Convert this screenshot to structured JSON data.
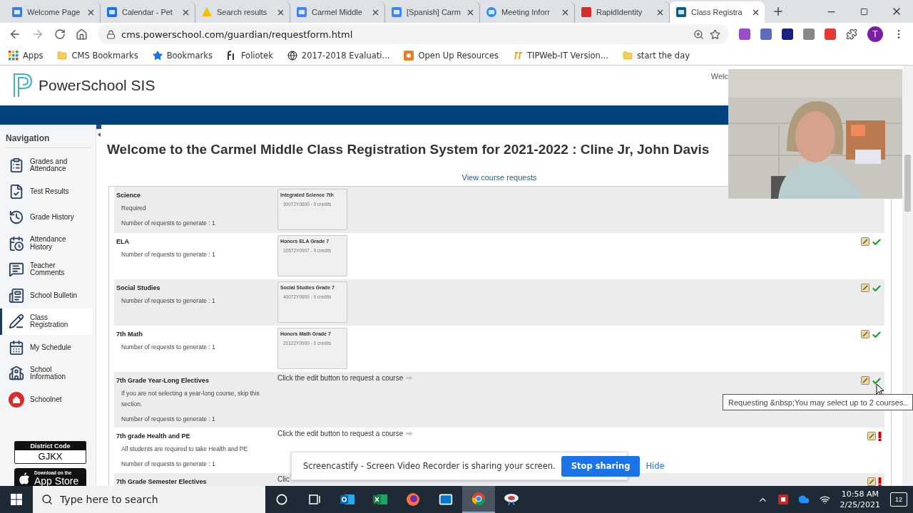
{
  "browser": {
    "tabs": [
      {
        "title": "Welcome Page",
        "selected": false
      },
      {
        "title": "Calendar - Pet",
        "selected": false
      },
      {
        "title": "Search results",
        "selected": false
      },
      {
        "title": "Carmel Middle",
        "selected": false
      },
      {
        "title": "[Spanish] Carm",
        "selected": false
      },
      {
        "title": "Meeting Inforr",
        "selected": false
      },
      {
        "title": "RapidIdentity",
        "selected": false
      },
      {
        "title": "Class Registra",
        "selected": true
      }
    ],
    "url": "cms.powerschool.com/guardian/requestform.html",
    "profile": "T",
    "bookmarks": [
      "Apps",
      "CMS Bookmarks",
      "Bookmarks",
      "Foliotek",
      "2017-2018 Evaluati...",
      "Open Up Resources",
      "TIPWeb-IT Version...",
      "start the day"
    ]
  },
  "header": {
    "logo": "PowerSchool SIS",
    "welcome": "Welc"
  },
  "sidebar": {
    "heading": "Navigation",
    "items": [
      {
        "label": "Grades and\nAttendance",
        "selected": false
      },
      {
        "label": "Test Results",
        "selected": false
      },
      {
        "label": "Grade History",
        "selected": false
      },
      {
        "label": "Attendance\nHistory",
        "selected": false
      },
      {
        "label": "Teacher\nComments",
        "selected": false
      },
      {
        "label": "School Bulletin",
        "selected": false
      },
      {
        "label": "Class\nRegistration",
        "selected": true
      },
      {
        "label": "My Schedule",
        "selected": false
      },
      {
        "label": "School\nInformation",
        "selected": false
      },
      {
        "label": "Schoolnet",
        "selected": false
      }
    ],
    "district_code": {
      "label": "District Code",
      "value": "GJKX"
    },
    "app_store": {
      "small": "Download on the",
      "big": "App Store"
    }
  },
  "main": {
    "title": "Welcome to the Carmel Middle Class Registration System for 2021-2022 : Cline Jr, John Davis",
    "link": "View course requests",
    "sections": [
      {
        "kind": "course",
        "title": "Science",
        "notes": [
          "Required"
        ],
        "requests": "Number of requests to generate : 1",
        "course": {
          "name": "Integrated Science 7th",
          "code": "30072Y0800 - 0 credits"
        }
      },
      {
        "kind": "course",
        "title": "ELA",
        "requests": "Number of requests to generate : 1",
        "course": {
          "name": "Honors ELA Grade 7",
          "code": "10572Y0907 - 0 credits"
        },
        "complete": true
      },
      {
        "kind": "course",
        "title": "Social Studies",
        "requests": "Number of requests to generate : 1",
        "course": {
          "name": "Social Studies Grade 7",
          "code": "40072Y0800 - 0 credits"
        },
        "complete": true
      },
      {
        "kind": "course",
        "title": "7th Math",
        "requests": "Number of requests to generate : 1",
        "course": {
          "name": "Honors Math Grade 7",
          "code": "20122Y0900 - 0 credits"
        },
        "complete": true
      },
      {
        "kind": "prompt",
        "title": "7th Grade Year-Long Electives",
        "notes": [
          "If you are not selecting a year-long course, skip this section."
        ],
        "requests": "Number of requests to generate : 1",
        "prompt": "Click the edit button to request a course",
        "hint_arrow": true,
        "complete": true
      },
      {
        "kind": "prompt",
        "title": "7th grade Health and PE",
        "notes": [
          "All students are required to take Health and PE"
        ],
        "requests": "Number of requests to generate : 1",
        "prompt": "Click the edit button to request a course",
        "hint_arrow": true,
        "complete": false
      },
      {
        "kind": "prompt",
        "title": "7th Grade Semester Electives",
        "prompt": "Clic",
        "hint_arrow": false,
        "complete": false
      }
    ]
  },
  "tooltip": "Requesting &nbsp;You may select up to 2 courses..",
  "share_bar": {
    "message": "Screencastify - Screen Video Recorder is sharing your screen.",
    "stop": "Stop sharing",
    "hide": "Hide"
  },
  "taskbar": {
    "search_placeholder": "Type here to search",
    "time": "10:58 AM",
    "date": "2/25/2021",
    "notifications": "12"
  }
}
